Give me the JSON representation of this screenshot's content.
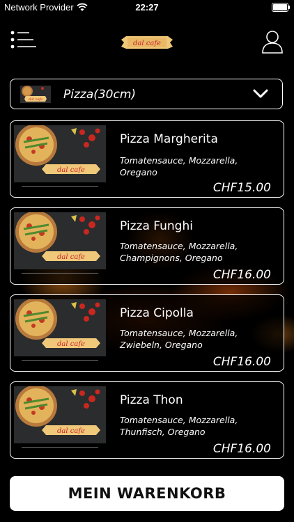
{
  "status_bar": {
    "provider": "Network Provider",
    "time": "22:27",
    "wifi_icon": "wifi-icon",
    "battery_icon": "battery-icon"
  },
  "header": {
    "menu_icon": "list-menu-icon",
    "logo_text": "dal cafe",
    "profile_icon": "user-profile-icon"
  },
  "category": {
    "label": "Pizza(30cm)",
    "thumbnail_logo": "dal cafe",
    "chevron_icon": "chevron-down-icon"
  },
  "products": [
    {
      "name": "Pizza Margherita",
      "description": "Tomatensauce, Mozzarella, Oregano",
      "price": "CHF15.00",
      "image_logo": "dal cafe"
    },
    {
      "name": "Pizza Funghi",
      "description": "Tomatensauce, Mozzarella, Champignons, Oregano",
      "price": "CHF16.00",
      "image_logo": "dal cafe"
    },
    {
      "name": "Pizza Cipolla",
      "description": "Tomatensauce, Mozzarella, Zwiebeln, Oregano",
      "price": "CHF16.00",
      "image_logo": "dal cafe"
    },
    {
      "name": "Pizza Thon",
      "description": "Tomatensauce, Mozzarella, Thunfisch, Oregano",
      "price": "CHF16.00",
      "image_logo": "dal cafe"
    }
  ],
  "cart": {
    "label": "MEIN WARENKORB"
  },
  "colors": {
    "background": "#000000",
    "card_border": "#ffffff",
    "button_background": "#ffffff",
    "button_text": "#111111",
    "logo_ribbon": "#f0c87a",
    "logo_text": "#c8282a"
  }
}
